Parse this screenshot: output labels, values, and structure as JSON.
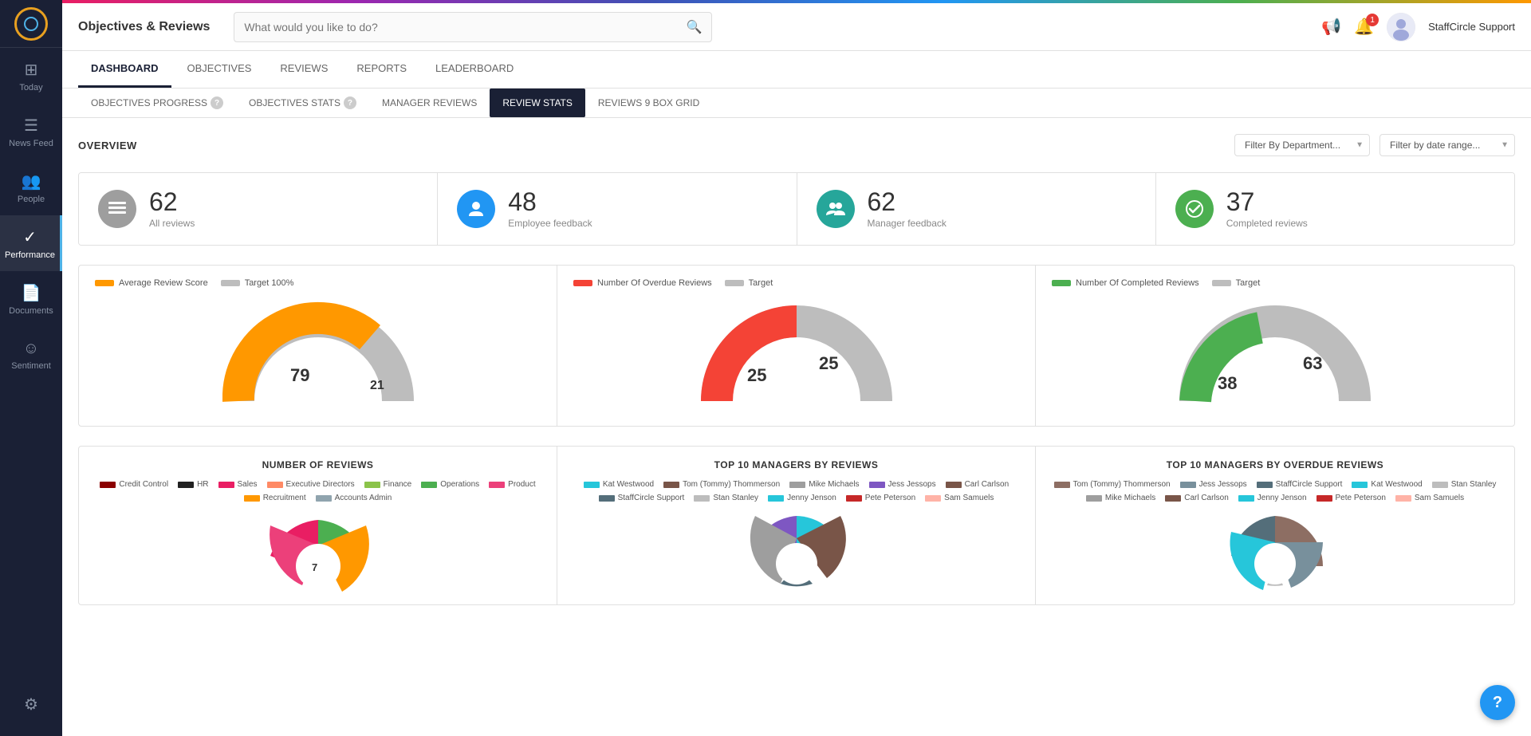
{
  "topbar": {
    "title": "Objectives & Reviews",
    "search_placeholder": "What would you like to do?",
    "user_name": "StaffCircle Support",
    "notification_count": "1"
  },
  "sidebar": {
    "items": [
      {
        "id": "today",
        "label": "Today",
        "icon": "⊞"
      },
      {
        "id": "newsfeed",
        "label": "News Feed",
        "icon": "☰"
      },
      {
        "id": "people",
        "label": "People",
        "icon": "👥"
      },
      {
        "id": "performance",
        "label": "Performance",
        "icon": "✓"
      },
      {
        "id": "documents",
        "label": "Documents",
        "icon": "📄"
      },
      {
        "id": "sentiment",
        "label": "Sentiment",
        "icon": "☺"
      }
    ],
    "settings_icon": "⚙"
  },
  "tabs_primary": [
    {
      "id": "dashboard",
      "label": "DASHBOARD",
      "active": true
    },
    {
      "id": "objectives",
      "label": "OBJECTIVES",
      "active": false
    },
    {
      "id": "reviews",
      "label": "REVIEWS",
      "active": false
    },
    {
      "id": "reports",
      "label": "REPORTS",
      "active": false
    },
    {
      "id": "leaderboard",
      "label": "LEADERBOARD",
      "active": false
    }
  ],
  "tabs_secondary": [
    {
      "id": "obj_progress",
      "label": "OBJECTIVES PROGRESS",
      "active": false,
      "has_help": true
    },
    {
      "id": "obj_stats",
      "label": "OBJECTIVES STATS",
      "active": false,
      "has_help": true
    },
    {
      "id": "manager_reviews",
      "label": "MANAGER REVIEWS",
      "active": false,
      "has_help": false
    },
    {
      "id": "review_stats",
      "label": "REVIEW STATS",
      "active": true,
      "has_help": false
    },
    {
      "id": "reviews_9box",
      "label": "REVIEWS 9 BOX GRID",
      "active": false,
      "has_help": false
    }
  ],
  "overview": {
    "title": "OVERVIEW",
    "filter_dept_placeholder": "Filter By Department...",
    "filter_date_placeholder": "Filter by date range..."
  },
  "stats": [
    {
      "id": "all_reviews",
      "number": "62",
      "label": "All reviews",
      "icon_type": "gray",
      "icon": "☰"
    },
    {
      "id": "employee_feedback",
      "number": "48",
      "label": "Employee feedback",
      "icon_type": "blue",
      "icon": "👤"
    },
    {
      "id": "manager_feedback",
      "number": "62",
      "label": "Manager feedback",
      "icon_type": "teal",
      "icon": "👥"
    },
    {
      "id": "completed_reviews",
      "number": "37",
      "label": "Completed reviews",
      "icon_type": "green",
      "icon": "✓"
    }
  ],
  "charts": [
    {
      "id": "avg_review_score",
      "legend": [
        {
          "label": "Average Review Score",
          "color": "orange"
        },
        {
          "label": "Target 100%",
          "color": "gray_light"
        }
      ],
      "value": 79,
      "secondary_value": 21,
      "primary_color": "#ff9800",
      "secondary_color": "#bdbdbd"
    },
    {
      "id": "overdue_reviews",
      "legend": [
        {
          "label": "Number Of Overdue Reviews",
          "color": "red"
        },
        {
          "label": "Target",
          "color": "gray_light"
        }
      ],
      "value": 25,
      "secondary_value": 25,
      "primary_color": "#f44336",
      "secondary_color": "#bdbdbd"
    },
    {
      "id": "completed_reviews_chart",
      "legend": [
        {
          "label": "Number Of Completed Reviews",
          "color": "green"
        },
        {
          "label": "Target",
          "color": "gray_light"
        }
      ],
      "value": 38,
      "secondary_value": 63,
      "primary_color": "#4caf50",
      "secondary_color": "#bdbdbd"
    }
  ],
  "bottom_charts": [
    {
      "id": "number_of_reviews",
      "title": "NUMBER OF REVIEWS",
      "legends": [
        {
          "label": "Credit Control",
          "color": "#8b0000"
        },
        {
          "label": "HR",
          "color": "#212121"
        },
        {
          "label": "Sales",
          "color": "#e91e63"
        },
        {
          "label": "Executive Directors",
          "color": "#ff8a65"
        },
        {
          "label": "Finance",
          "color": "#8bc34a"
        },
        {
          "label": "Operations",
          "color": "#4caf50"
        },
        {
          "label": "Product",
          "color": "#e91e63"
        },
        {
          "label": "Recruitment",
          "color": "#ff9800"
        },
        {
          "label": "Accounts Admin",
          "color": "#90a4ae"
        }
      ],
      "pie_value": 7
    },
    {
      "id": "top10_managers_reviews",
      "title": "TOP 10 MANAGERS BY REVIEWS",
      "legends": [
        {
          "label": "Kat Westwood",
          "color": "#26c6da"
        },
        {
          "label": "Tom (Tommy) Thommerson",
          "color": "#795548"
        },
        {
          "label": "Mike Michaels",
          "color": "#9e9e9e"
        },
        {
          "label": "Jess Jessops",
          "color": "#7e57c2"
        },
        {
          "label": "Carl Carlson",
          "color": "#795548"
        },
        {
          "label": "StaffCircle Support",
          "color": "#546e7a"
        },
        {
          "label": "Stan Stanley",
          "color": "#bdbdbd"
        },
        {
          "label": "Jenny Jenson",
          "color": "#26c6da"
        },
        {
          "label": "Pete Peterson",
          "color": "#c62828"
        },
        {
          "label": "Sam Samuels",
          "color": "#ffb3a7"
        }
      ]
    },
    {
      "id": "top10_managers_overdue",
      "title": "TOP 10 MANAGERS BY OVERDUE REVIEWS",
      "legends": [
        {
          "label": "Tom (Tommy) Thommerson",
          "color": "#8d6e63"
        },
        {
          "label": "Jess Jessops",
          "color": "#78909c"
        },
        {
          "label": "StaffCircle Support",
          "color": "#546e7a"
        },
        {
          "label": "Kat Westwood",
          "color": "#26c6da"
        },
        {
          "label": "Stan Stanley",
          "color": "#bdbdbd"
        },
        {
          "label": "Mike Michaels",
          "color": "#9e9e9e"
        },
        {
          "label": "Carl Carlson",
          "color": "#795548"
        },
        {
          "label": "Jenny Jenson",
          "color": "#26c6da"
        },
        {
          "label": "Pete Peterson",
          "color": "#c62828"
        },
        {
          "label": "Sam Samuels",
          "color": "#ffb3a7"
        }
      ]
    }
  ],
  "help_icon": "?",
  "chevron_down": "▼"
}
